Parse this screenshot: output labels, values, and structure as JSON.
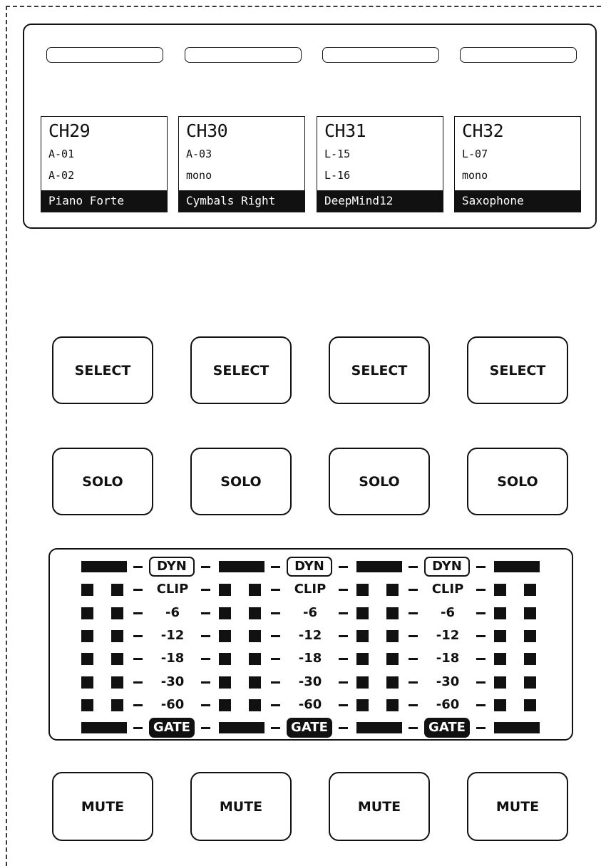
{
  "channels": [
    {
      "ch": "CH29",
      "src1": "A-01",
      "src2": "A-02",
      "name": "Piano Forte"
    },
    {
      "ch": "CH30",
      "src1": "A-03",
      "src2": "mono",
      "name": "Cymbals Right"
    },
    {
      "ch": "CH31",
      "src1": "L-15",
      "src2": "L-16",
      "name": "DeepMind12"
    },
    {
      "ch": "CH32",
      "src1": "L-07",
      "src2": "mono",
      "name": "Saxophone"
    }
  ],
  "buttons": {
    "select_label": "SELECT",
    "solo_label": "SOLO",
    "mute_label": "MUTE"
  },
  "meter": {
    "dyn_label": "DYN",
    "gate_label": "GATE",
    "levels": [
      "CLIP",
      "-6",
      "-12",
      "-18",
      "-30",
      "-60"
    ]
  },
  "colors": {
    "outline": "#111111",
    "lcd_name_bg": "#111111",
    "lcd_name_text": "#ffffff",
    "background": "#ffffff"
  }
}
